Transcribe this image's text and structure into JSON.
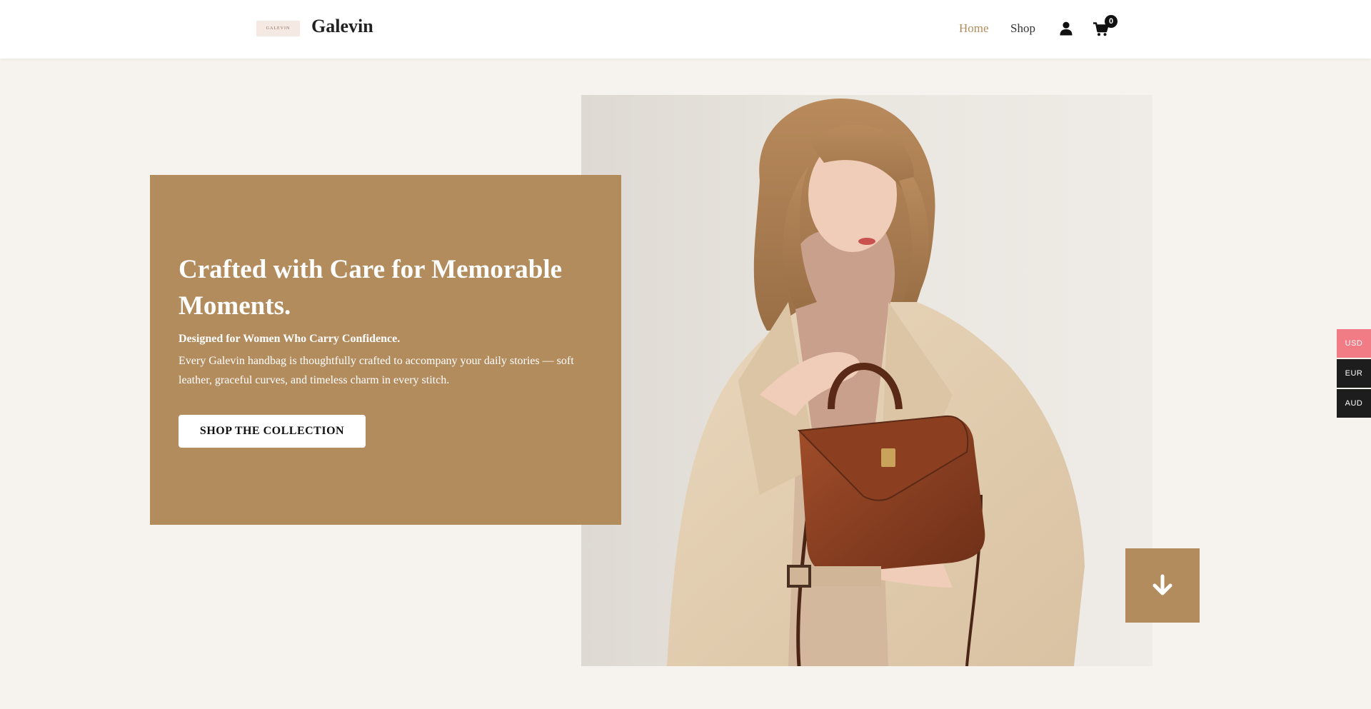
{
  "header": {
    "logo_text": "GALEVIN",
    "brand": "Galevin",
    "nav": {
      "home": "Home",
      "shop": "Shop"
    },
    "icons": {
      "user": "user-icon",
      "cart": "cart-icon"
    },
    "cart_count": "0"
  },
  "hero": {
    "title": "Crafted with Care for Memorable Moments.",
    "subtitle": "Designed for Women Who Carry Confidence.",
    "body": "Every Galevin handbag is thoughtfully crafted to accompany your daily stories — soft leather, graceful curves, and timeless charm in every stitch.",
    "cta_label": "SHOP THE COLLECTION",
    "scroll_icon": "arrow-down-icon"
  },
  "currency": {
    "options": [
      "USD",
      "EUR",
      "AUD"
    ],
    "selected": "USD"
  },
  "colors": {
    "accent": "#b38c5e",
    "background": "#f6f3ee",
    "currency_active": "#f27c86",
    "currency_inactive": "#1d1d1d"
  }
}
